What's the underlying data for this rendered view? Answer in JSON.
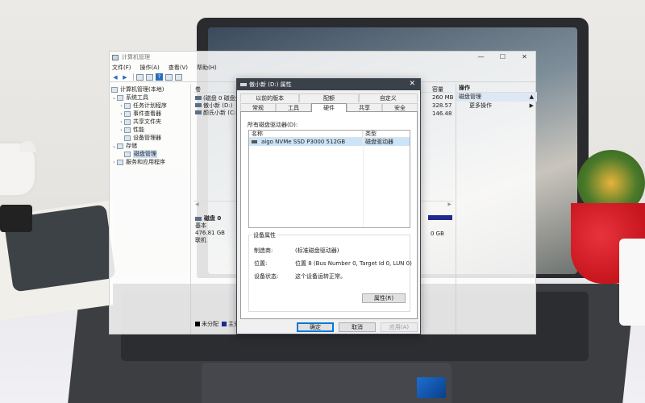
{
  "window": {
    "title": "计算机管理",
    "controls": [
      "—",
      "☐",
      "✕"
    ]
  },
  "menu": [
    "文件(F)",
    "操作(A)",
    "查看(V)",
    "帮助(H)"
  ],
  "tree": {
    "root": "计算机管理(本地)",
    "system_tools": "系统工具",
    "task_scheduler": "任务计划程序",
    "event_viewer": "事件查看器",
    "shared_folders": "共享文件夹",
    "performance": "性能",
    "device_manager": "设备管理器",
    "storage": "存储",
    "disk_management": "磁盘管理",
    "services": "服务和应用程序"
  },
  "volume_list": {
    "header_volume": "卷",
    "header_capacity": "容量",
    "rows": [
      {
        "name": "(磁盘 0 磁盘分...",
        "capacity": "260 MB"
      },
      {
        "name": "傲小新 (D:)",
        "capacity": "328.57"
      },
      {
        "name": "颜氏小新 (C:)",
        "capacity": "146.48"
      }
    ]
  },
  "disk0": {
    "title": "磁盘 0",
    "type": "基本",
    "size": "476.81 GB",
    "status": "联机",
    "volume_size": "0 GB"
  },
  "legend": {
    "unallocated": "未分配",
    "primary": "主分"
  },
  "actions": {
    "header": "操作",
    "selected": "磁盘管理",
    "more": "更多操作"
  },
  "dialog": {
    "title": "傲小新 (D:) 属性",
    "tabs_row1": [
      "以前的版本",
      "配额",
      "自定义"
    ],
    "tabs_row2": [
      "常规",
      "工具",
      "硬件",
      "共享",
      "安全"
    ],
    "all_drives_label": "所有磁盘驱动器(D):",
    "col_name": "名称",
    "col_type": "类型",
    "drive_name": "aigo NVMe SSD P3000 512GB",
    "drive_type": "磁盘驱动器",
    "group_label": "设备属性",
    "manufacturer_key": "制造商:",
    "manufacturer_val": "(标准磁盘驱动器)",
    "location_key": "位置:",
    "location_val": "位置 8 (Bus Number 0, Target Id 0, LUN 0)",
    "status_key": "设备状态:",
    "status_val": "这个设备运转正常。",
    "properties_btn": "属性(R)",
    "ok_btn": "确定",
    "cancel_btn": "取消",
    "apply_btn": "应用(A)"
  },
  "colors": {
    "dialog_title_bg": "#3b4149",
    "selection": "#cce4f7",
    "volume_bar": "#1f2a8c"
  }
}
